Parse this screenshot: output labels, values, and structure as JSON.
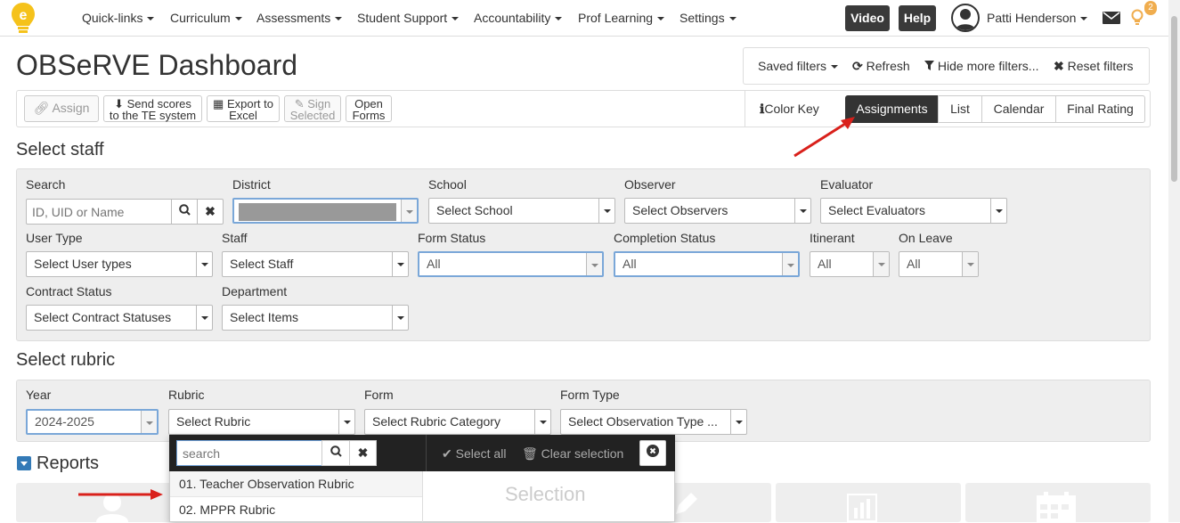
{
  "nav": {
    "items": [
      "Quick-links",
      "Curriculum",
      "Assessments",
      "Student Support",
      "Accountability",
      "Prof Learning",
      "Settings"
    ],
    "video": "Video",
    "help": "Help",
    "user": "Patti Henderson",
    "notif_count": "2"
  },
  "page": {
    "title": "OBSeRVE Dashboard"
  },
  "filters": {
    "saved": "Saved filters",
    "refresh": "Refresh",
    "hide": "Hide more filters...",
    "reset": "Reset filters"
  },
  "toolbar": {
    "assign": "Assign",
    "send_1": "Send scores",
    "send_2": "to the TE system",
    "export_1": "Export to",
    "export_2": "Excel",
    "sign_1": "Sign",
    "sign_2": "Selected",
    "open_1": "Open",
    "open_2": "Forms",
    "color_key": "Color Key",
    "tabs": [
      "Assignments",
      "List",
      "Calendar",
      "Final Rating"
    ]
  },
  "staff": {
    "heading": "Select staff",
    "search_label": "Search",
    "search_placeholder": "ID, UID or Name",
    "district_label": "District",
    "school_label": "School",
    "school_value": "Select School",
    "observer_label": "Observer",
    "observer_value": "Select Observers",
    "evaluator_label": "Evaluator",
    "evaluator_value": "Select Evaluators",
    "usertype_label": "User Type",
    "usertype_value": "Select User types",
    "staff_label": "Staff",
    "staff_value": "Select Staff",
    "formstatus_label": "Form Status",
    "formstatus_value": "All",
    "completion_label": "Completion Status",
    "completion_value": "All",
    "itinerant_label": "Itinerant",
    "itinerant_value": "All",
    "onleave_label": "On Leave",
    "onleave_value": "All",
    "contract_label": "Contract Status",
    "contract_value": "Select Contract Statuses",
    "department_label": "Department",
    "department_value": "Select Items"
  },
  "rubric": {
    "heading": "Select rubric",
    "year_label": "Year",
    "year_value": "2024-2025",
    "rubric_label": "Rubric",
    "rubric_value": "Select Rubric",
    "form_label": "Form",
    "form_value": "Select Rubric Category",
    "formtype_label": "Form Type",
    "formtype_value": "Select Observation Type ..."
  },
  "dropdown": {
    "search_placeholder": "search",
    "select_all": "Select all",
    "clear": "Clear selection",
    "items": [
      "01. Teacher Observation Rubric",
      "02. MPPR Rubric"
    ],
    "selection_title": "Selection"
  },
  "reports": {
    "heading": "Reports"
  },
  "colors": {
    "accent": "#337ab7",
    "dark": "#333333",
    "arrow": "#d9201b",
    "badge": "#f0ad4e"
  }
}
